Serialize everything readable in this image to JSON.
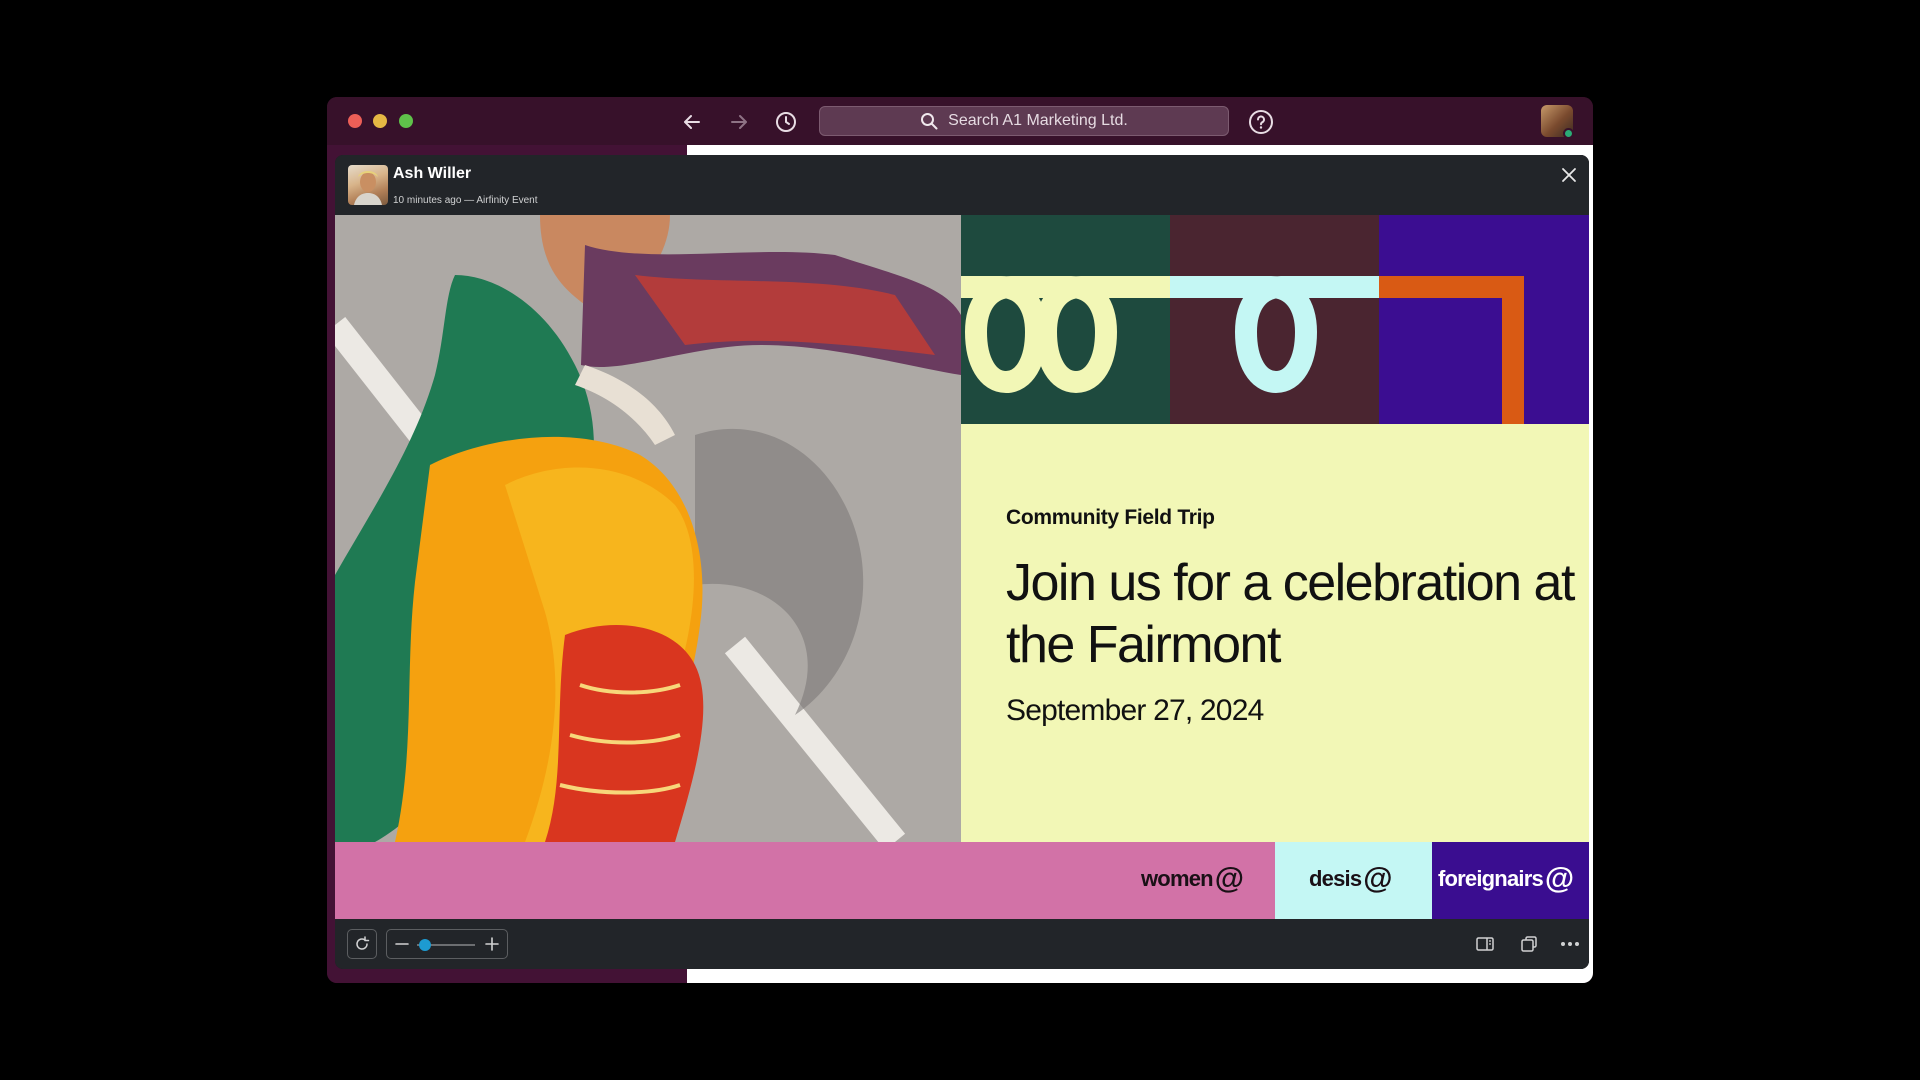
{
  "toolbar": {
    "search_placeholder": "Search A1 Marketing Ltd."
  },
  "viewer": {
    "author": "Ash Willer",
    "meta": "10 minutes ago — Airfinity Event"
  },
  "poster": {
    "kicker": "Community Field Trip",
    "headline": "Join us for a celebration at the Fairmont",
    "date": "September 27, 2024",
    "tags": [
      {
        "label": "women",
        "color": "#d272a7"
      },
      {
        "label": "desis",
        "color": "#c4f7f4"
      },
      {
        "label": "foreignairs",
        "color": "#3a0d90"
      }
    ],
    "at_symbol": "@"
  },
  "zoom": {
    "level": 0.05
  },
  "colors": {
    "titlebar": "#37112a",
    "poster_card": "#f2f7b6",
    "block_green": "#1e4a3e",
    "block_maroon": "#4a2530",
    "block_purple": "#3b0d91",
    "accent_blue": "#1d9bd1"
  }
}
